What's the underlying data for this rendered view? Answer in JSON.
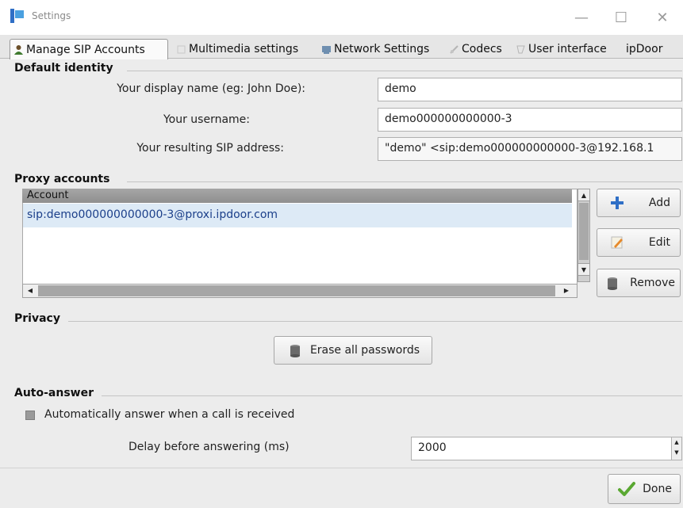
{
  "window": {
    "title": "Settings",
    "controls": {
      "minimize": "—",
      "maximize": "☐",
      "close": "✕"
    }
  },
  "tabs": [
    {
      "label": "Manage SIP Accounts",
      "active": true,
      "icon": "account-icon"
    },
    {
      "label": "Multimedia settings",
      "active": false,
      "icon": "multimedia-icon"
    },
    {
      "label": "Network Settings",
      "active": false,
      "icon": "network-icon"
    },
    {
      "label": "Codecs",
      "active": false,
      "icon": "codecs-icon"
    },
    {
      "label": "User interface",
      "active": false,
      "icon": "ui-icon"
    },
    {
      "label": "ipDoor",
      "active": false,
      "icon": ""
    }
  ],
  "default_identity": {
    "heading": "Default identity",
    "display_name_label": "Your display name (eg: John Doe):",
    "display_name_value": "demo",
    "username_label": "Your username:",
    "username_value": "demo000000000000-3",
    "sip_address_label": "Your resulting SIP address:",
    "sip_address_value": "\"demo\" <sip:demo000000000000-3@192.168.1"
  },
  "proxy_accounts": {
    "heading": "Proxy accounts",
    "column_header": "Account",
    "rows": [
      "sip:demo000000000000-3@proxi.ipdoor.com"
    ],
    "buttons": {
      "add": "Add",
      "edit": "Edit",
      "remove": "Remove"
    }
  },
  "privacy": {
    "heading": "Privacy",
    "erase_button": "Erase all passwords"
  },
  "auto_answer": {
    "heading": "Auto-answer",
    "checkbox_label": "Automatically answer when a call is received",
    "checked": false,
    "delay_label": "Delay before answering (ms)",
    "delay_value": "2000"
  },
  "footer": {
    "done_button": "Done"
  },
  "colors": {
    "accent_blue": "#2f6fc6",
    "done_green": "#5aa832",
    "selection": "#ddeaf6"
  }
}
